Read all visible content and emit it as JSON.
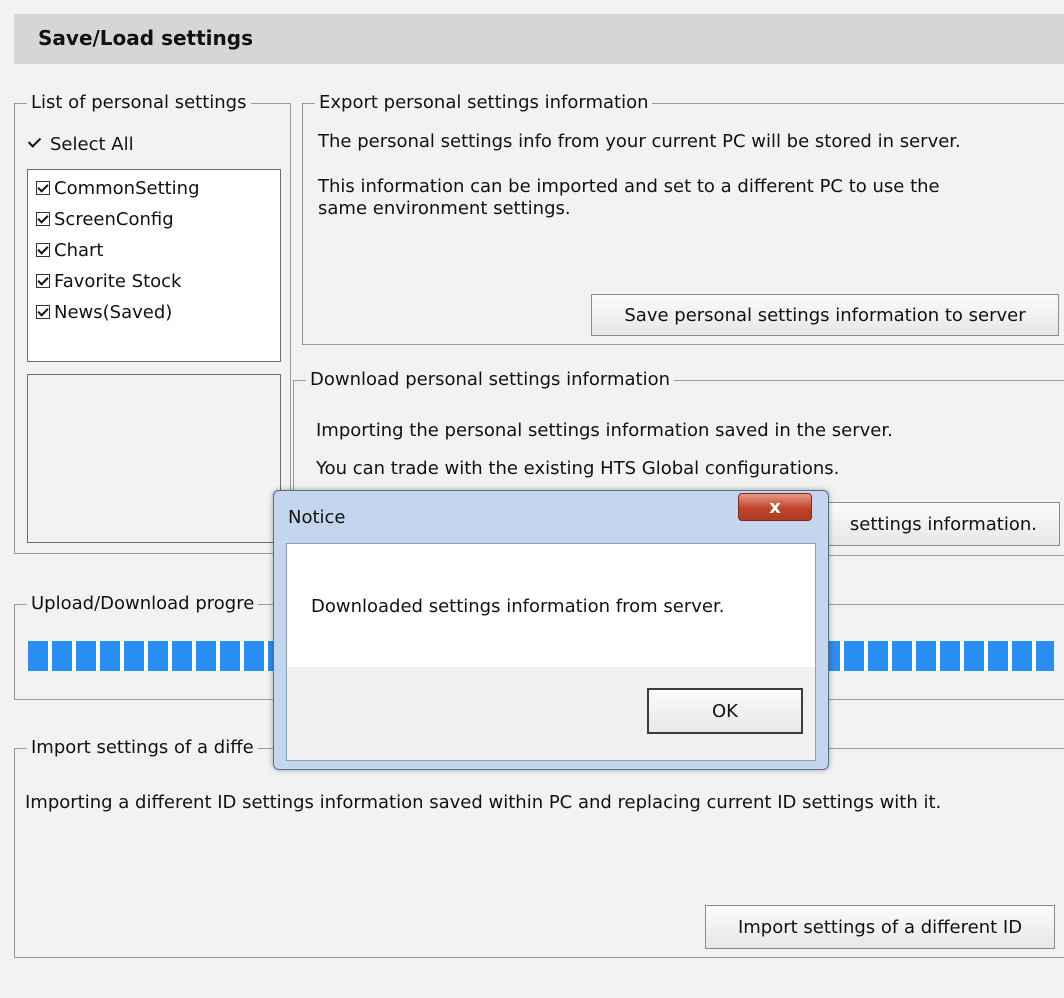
{
  "header": {
    "title": "Save/Load settings"
  },
  "personal_list": {
    "legend": "List of personal settings",
    "select_all": {
      "label": "Select All",
      "checked": true
    },
    "items": [
      {
        "label": "CommonSetting",
        "checked": true
      },
      {
        "label": "ScreenConfig",
        "checked": true
      },
      {
        "label": "Chart",
        "checked": true
      },
      {
        "label": "Favorite Stock",
        "checked": true
      },
      {
        "label": "News(Saved)",
        "checked": true
      }
    ]
  },
  "export": {
    "legend": "Export personal settings information",
    "line1": "The personal settings info from your current PC will be stored in server.",
    "line2": "This information can be imported and set to a different PC to use the",
    "line3": "same environment settings.",
    "button": "Save personal settings information to server"
  },
  "download": {
    "legend": "Download personal settings information",
    "line1": "Importing the personal settings information saved in the server.",
    "line2": "You can trade with the existing HTS Global configurations.",
    "button_visible": "settings information."
  },
  "progress": {
    "legend": "Upload/Download progre",
    "percent": 100
  },
  "import": {
    "legend": "Import settings of a diffe",
    "description": "Importing a different ID settings information saved within PC and replacing current ID settings with it.",
    "button": "Import settings of a different ID"
  },
  "dialog": {
    "title": "Notice",
    "close_label": "x",
    "message": "Downloaded settings information from server.",
    "ok_label": "OK"
  },
  "colors": {
    "progress_fill": "#2a8ff2",
    "close_button": "#c0432b",
    "dialog_frame": "#c3d6ee"
  }
}
